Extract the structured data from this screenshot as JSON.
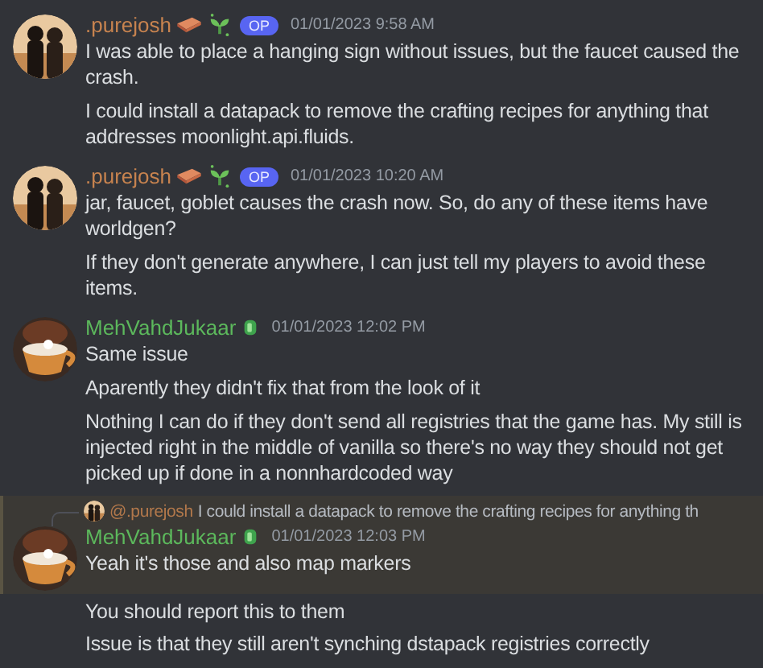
{
  "messages": [
    {
      "author": ".purejosh",
      "color": "#c7834f",
      "badges": [
        {
          "kind": "brick"
        },
        {
          "kind": "sprout"
        }
      ],
      "op_label": "OP",
      "timestamp": "01/01/2023 9:58 AM",
      "avatar": {
        "kind": "figures"
      },
      "highlighted": false,
      "paragraphs": [
        "I was able to place a hanging sign without issues, but the faucet caused the crash.",
        "I could install a datapack to remove the crafting recipes for anything that addresses moonlight.api.fluids."
      ]
    },
    {
      "author": ".purejosh",
      "color": "#c7834f",
      "badges": [
        {
          "kind": "brick"
        },
        {
          "kind": "sprout"
        }
      ],
      "op_label": "OP",
      "timestamp": "01/01/2023 10:20 AM",
      "avatar": {
        "kind": "figures"
      },
      "highlighted": false,
      "paragraphs": [
        "jar, faucet, goblet causes the crash now. So, do any of these items have worldgen?",
        "If they don't generate anywhere, I can just tell my players to avoid these items."
      ]
    },
    {
      "author": "MehVahdJukaar",
      "color": "#5cb85c",
      "badges": [
        {
          "kind": "gem"
        }
      ],
      "timestamp": "01/01/2023 12:02 PM",
      "avatar": {
        "kind": "teacup"
      },
      "highlighted": false,
      "paragraphs": [
        "Same issue",
        "Aparently they didn't fix that from the look of it",
        "Nothing I can do if they don't send all registries that the game has. My still is injected right in the middle of vanilla so there's no way they should not get picked up if done in a nonnhardcoded way"
      ]
    },
    {
      "reply": {
        "author": "@.purejosh",
        "text": "I could install a datapack to remove the crafting recipes for anything th",
        "avatar": {
          "kind": "figures"
        }
      },
      "author": "MehVahdJukaar",
      "color": "#5cb85c",
      "badges": [
        {
          "kind": "gem"
        }
      ],
      "timestamp": "01/01/2023 12:03 PM",
      "avatar": {
        "kind": "teacup"
      },
      "highlighted": true,
      "paragraphs": [
        "Yeah it's those and also map markers"
      ]
    },
    {
      "highlighted": false,
      "paragraphs": [
        "You should report this to them",
        "Issue is that they still aren't synching dstapack registries correctly"
      ]
    }
  ]
}
